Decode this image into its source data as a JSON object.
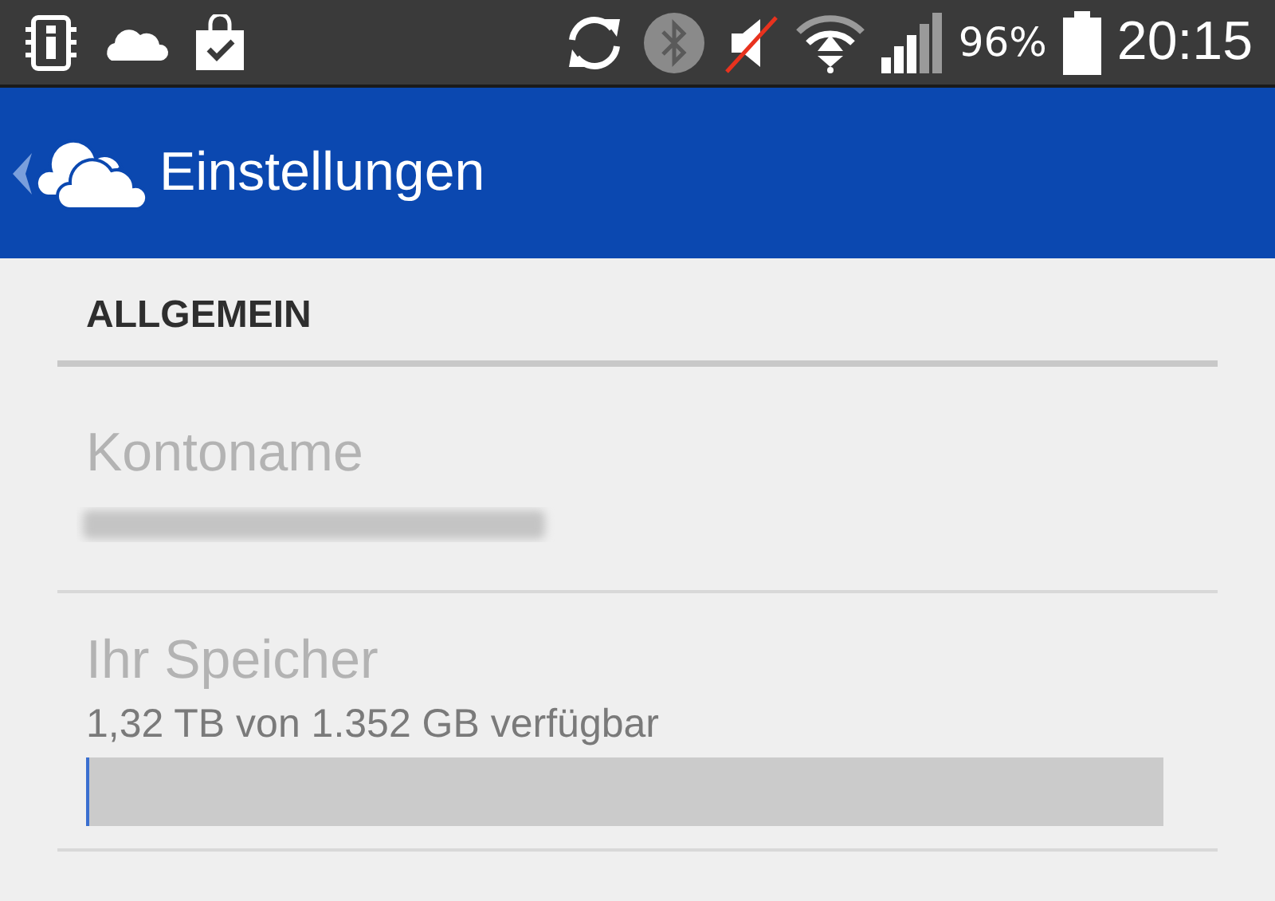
{
  "status_bar": {
    "battery_percent": "96%",
    "time": "20:15"
  },
  "app_bar": {
    "title": "Einstellungen"
  },
  "section": {
    "header": "ALLGEMEIN"
  },
  "settings": [
    {
      "kind": "account",
      "label": "Kontoname"
    },
    {
      "kind": "storage",
      "label": "Ihr Speicher",
      "summary": "1,32 TB von 1.352 GB verfügbar",
      "level": 0.003
    }
  ]
}
